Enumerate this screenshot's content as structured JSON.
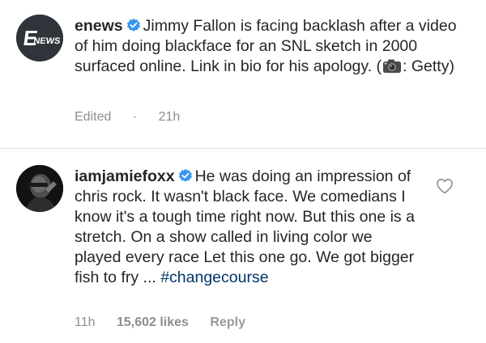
{
  "caption": {
    "username": "enews",
    "text_before_icon": "Jimmy Fallon is facing backlash after a video of him doing blackface for an SNL sketch in 2000 surfaced online. Link in bio for his apology. (",
    "text_after_icon": ": Getty)",
    "avatar_text": "E NEWS",
    "meta": {
      "edited_label": "Edited",
      "separator": "·",
      "time": "21h"
    }
  },
  "comment": {
    "username": "iamjamiefoxx",
    "text": "He was doing an impression of chris rock. It wasn't black face. We comedians  I know it's a tough time right now. But this one is a stretch. On a show called in living color we played every race  Let this one go. We got bigger fish to fry ... ",
    "hashtag": "#changecourse",
    "meta": {
      "time": "11h",
      "likes": "15,602 likes",
      "reply": "Reply"
    }
  },
  "icons": {
    "verified": "verified-badge-icon",
    "camera": "camera-emoji-icon",
    "like": "heart-outline-icon"
  },
  "colors": {
    "verified_blue": "#3897f0",
    "hashtag": "#003569",
    "meta_gray": "#8e8e8e",
    "text": "#262626"
  }
}
